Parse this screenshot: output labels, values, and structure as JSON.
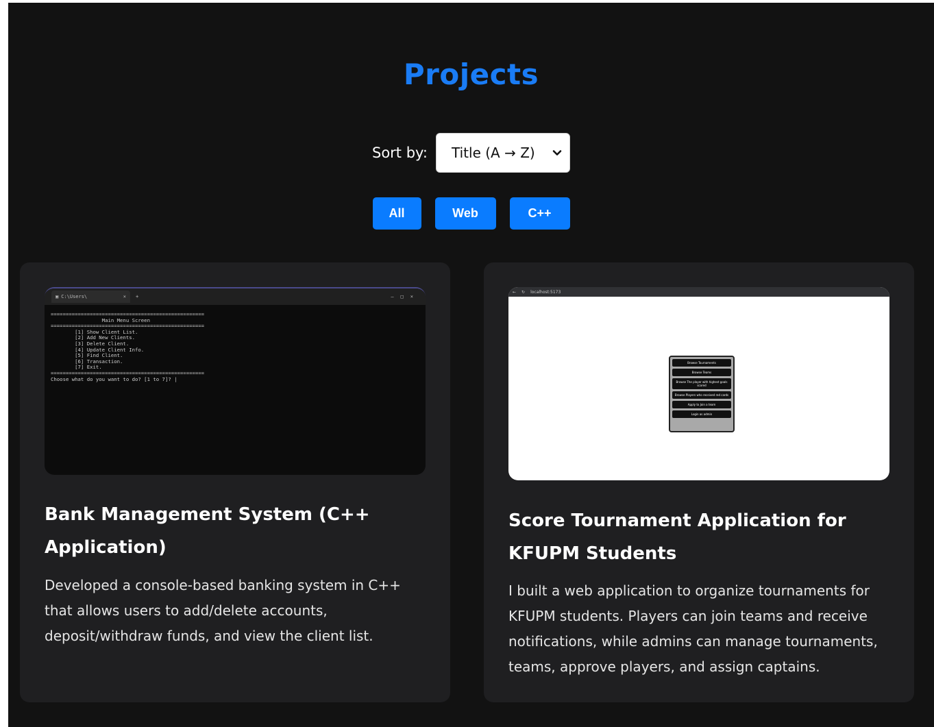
{
  "page": {
    "title": "Projects"
  },
  "sort": {
    "label": "Sort by:",
    "selected": "Title (A → Z)"
  },
  "filters": [
    {
      "label": "All"
    },
    {
      "label": "Web"
    },
    {
      "label": "C++"
    }
  ],
  "projects": [
    {
      "title": "Bank Management System (C++ Application)",
      "description": "Developed a console-based banking system in C++ that allows users to add/delete accounts, deposit/withdraw funds, and view the client list.",
      "screenshot": {
        "tab_label": "C:\\Users\\",
        "lines": [
          "===================================================",
          "                 Main Menu Screen",
          "===================================================",
          "        [1] Show Client List.",
          "        [2] Add New Clients.",
          "        [3] Delete Client.",
          "        [4] Update Client Info.",
          "        [5] Find Client.",
          "        [6] Transaction.",
          "        [7] Exit.",
          "===================================================",
          "Choose what do you want to do? [1 to 7]? |"
        ]
      }
    },
    {
      "title": "Score Tournament Application for KFUPM Students",
      "description": "I built a web application to organize tournaments for KFUPM students. Players can join teams and receive notifications, while admins can manage tournaments, teams, approve players, and assign captains.",
      "screenshot": {
        "address": "localhost:5173",
        "menu_items": [
          "Browse Tournaments",
          "Browse Teams",
          "Browse The player with highest goals scored",
          "Browse Players who received red cards",
          "Apply to Join a team",
          "Login as admin"
        ]
      }
    }
  ],
  "colors": {
    "background": "#121212",
    "card": "#1f1f21",
    "accent": "#0a7cff",
    "title": "#1a7cf5"
  }
}
